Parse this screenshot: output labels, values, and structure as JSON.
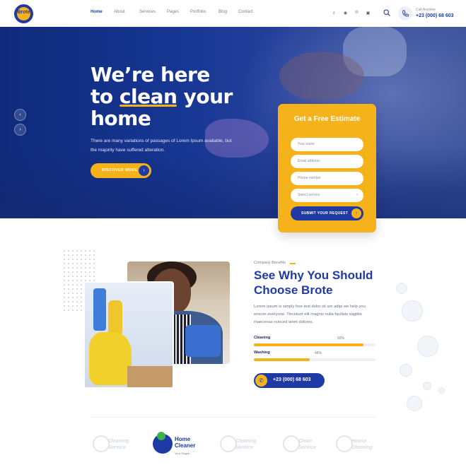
{
  "header": {
    "logo_text": "Brote",
    "nav": [
      "Home",
      "About",
      "Services",
      "Pages",
      "Portfolio",
      "Blog",
      "Contact"
    ],
    "socials": [
      "twitter-icon",
      "facebook-icon",
      "pinterest-icon",
      "instagram-icon"
    ],
    "call_label": "Call Anytime",
    "call_number": "+23 (000) 68 603"
  },
  "hero": {
    "title_line1": "We’re here",
    "title_line2_pre": "to ",
    "title_line2_highlight": "clean",
    "title_line2_post": " your",
    "title_line3": "home",
    "description": "There are many variations of passages of Lorem Ipsum available, but the majority have suffered alteration.",
    "button_label": "DISCOVER MORE"
  },
  "quote": {
    "title": "Get a Free Estimate",
    "name_placeholder": "Your name",
    "email_placeholder": "Email address",
    "phone_placeholder": "Phone number",
    "service_placeholder": "Select service",
    "submit_label": "SUBMIT YOUR REQUEST"
  },
  "about": {
    "label": "Company Benefits",
    "title": "See Why You Should Choose Brote",
    "description": "Lorem ipsum is simply free text dolor sit am adipi we help you ensure everyone. Tincidunt elit magnis nulla facilisis sagittis maecenas nunced amet dolores.",
    "bars": [
      {
        "label": "Cleaning",
        "percent_text": "90%",
        "value": 0.9
      },
      {
        "label": "Washing",
        "percent_text": "46%",
        "value": 0.46
      }
    ],
    "phone_button": "+23 (000) 68 603"
  },
  "brands": [
    {
      "name": "Cleaning Service"
    },
    {
      "name": "Home Cleaner",
      "slogan": "Your Slogan"
    },
    {
      "name": "Cleaning Service"
    },
    {
      "name": "Clean Service"
    },
    {
      "name": "House Cleaning"
    }
  ]
}
